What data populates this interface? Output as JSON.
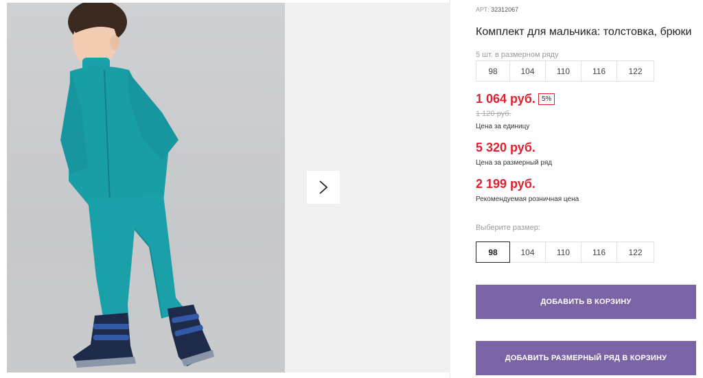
{
  "product": {
    "sku_label": "АРТ:",
    "sku_value": "32312067",
    "title": "Комплект для мальчика: толстовка, брюки",
    "row_note": "5 шт. в размерном ряду",
    "image_alt": "boy-in-teal-fleece-suit"
  },
  "size_row": [
    "98",
    "104",
    "110",
    "116",
    "122"
  ],
  "prices": {
    "unit_price": "1 064 руб.",
    "discount": "5%",
    "old_price": "1 120 руб.",
    "unit_caption": "Цена за единицу",
    "row_price": "5 320 руб.",
    "row_caption": "Цена за размерный ряд",
    "retail_price": "2 199 руб.",
    "retail_caption": "Рекомендуемая розничная цена"
  },
  "size_select": {
    "label": "Выберите размер:",
    "options": [
      "98",
      "104",
      "110",
      "116",
      "122"
    ],
    "selected": "98"
  },
  "buttons": {
    "add_to_cart": "ДОБАВИТЬ В КОРЗИНУ",
    "add_row_to_cart": "ДОБАВИТЬ РАЗМЕРНЫЙ РЯД В КОРЗИНУ"
  },
  "gallery": {
    "next_icon": "chevron-right-icon"
  },
  "colors": {
    "accent": "#7b64a6",
    "price": "#e0202e",
    "suit": "#1aa0a8"
  }
}
